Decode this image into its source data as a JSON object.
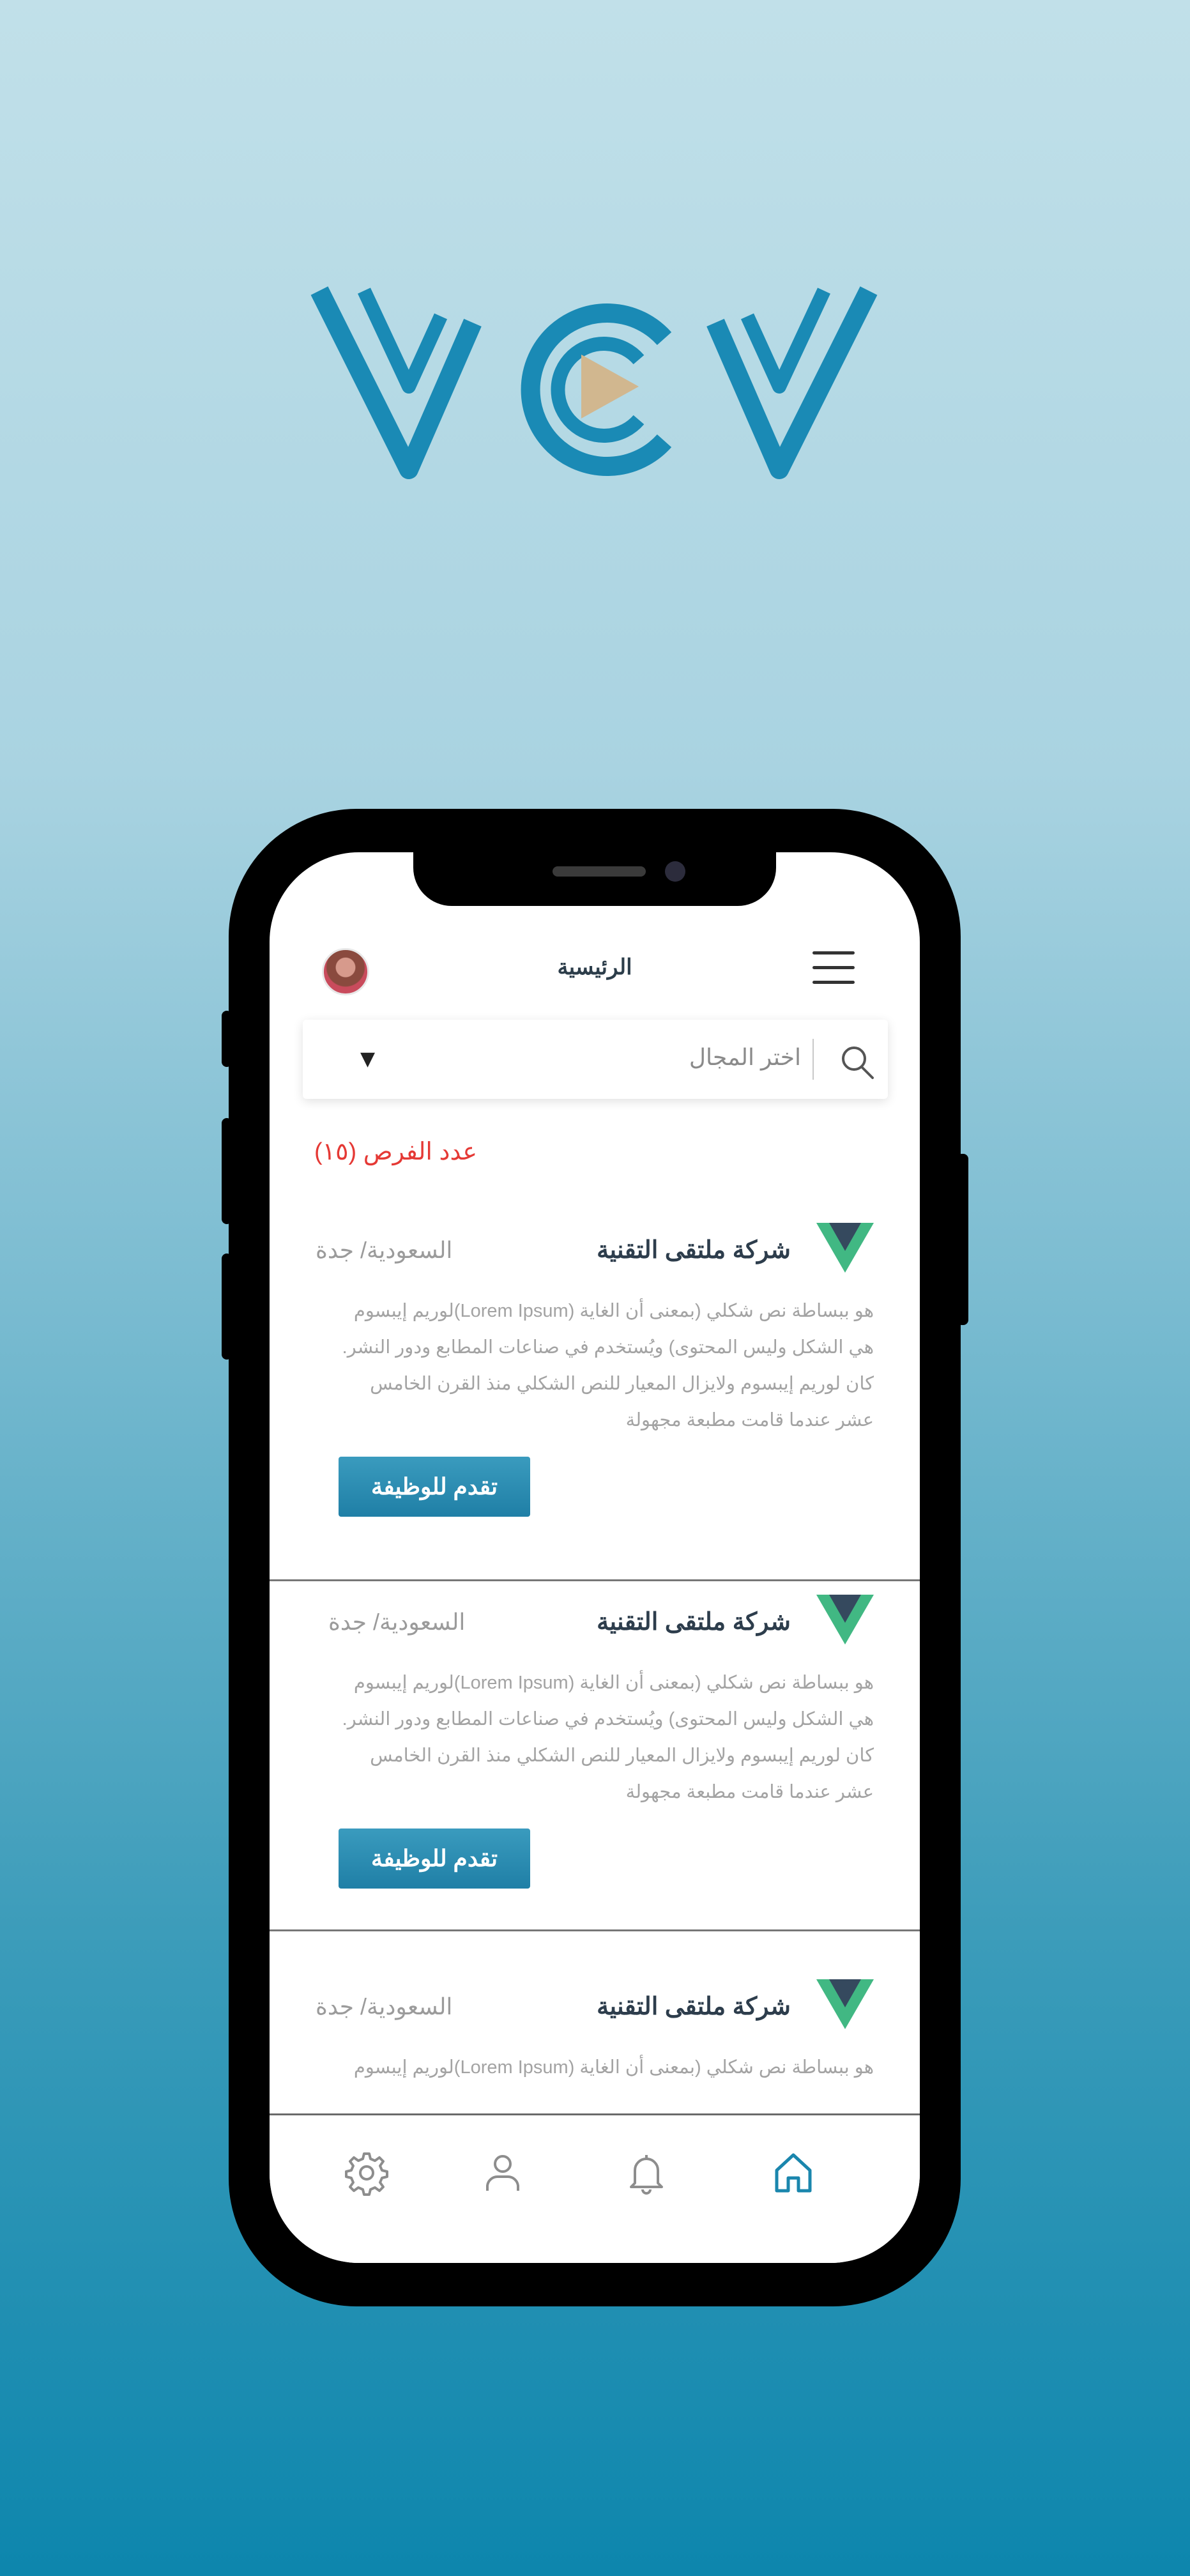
{
  "brand": {
    "logo_text": "VCV",
    "logo_icon": "play-icon"
  },
  "app": {
    "title": "الرئيسية",
    "search": {
      "placeholder": "اختر المجال"
    },
    "opportunities_count": "عدد الفرص (١٥)",
    "jobs": [
      {
        "company": "شركة ملتقى التقنية",
        "location": "السعودية/ جدة",
        "description": "هو ببساطة نص شكلي (بمعنى أن الغاية (Lorem Ipsum)لوريم إيبسوم هي الشكل وليس المحتوى) ويُستخدم في صناعات المطابع ودور النشر. كان لوريم إيبسوم ولايزال المعيار للنص الشكلي منذ القرن الخامس عشر عندما قامت مطبعة مجهولة",
        "apply_label": "تقدم للوظيفة"
      },
      {
        "company": "شركة ملتقى التقنية",
        "location": "السعودية/ جدة",
        "description": "هو ببساطة نص شكلي (بمعنى أن الغاية (Lorem Ipsum)لوريم إيبسوم هي الشكل وليس المحتوى) ويُستخدم في صناعات المطابع ودور النشر. كان لوريم إيبسوم ولايزال المعيار للنص الشكلي منذ القرن الخامس عشر عندما قامت مطبعة مجهولة",
        "apply_label": "تقدم للوظيفة"
      },
      {
        "company": "شركة ملتقى التقنية",
        "location": "السعودية/ جدة",
        "description": "هو ببساطة نص شكلي (بمعنى أن الغاية (Lorem Ipsum)لوريم إيبسوم"
      }
    ],
    "tabs": [
      {
        "icon": "home-icon",
        "active": true
      },
      {
        "icon": "bell-icon",
        "active": false
      },
      {
        "icon": "user-icon",
        "active": false
      },
      {
        "icon": "gear-icon",
        "active": false
      }
    ]
  },
  "colors": {
    "accent": "#1a86ad",
    "count_red": "#e53935",
    "logo_blue": "#1a8ab5",
    "logo_play": "#d1b78f",
    "vue_green": "#41b883",
    "vue_dark": "#35495e"
  }
}
